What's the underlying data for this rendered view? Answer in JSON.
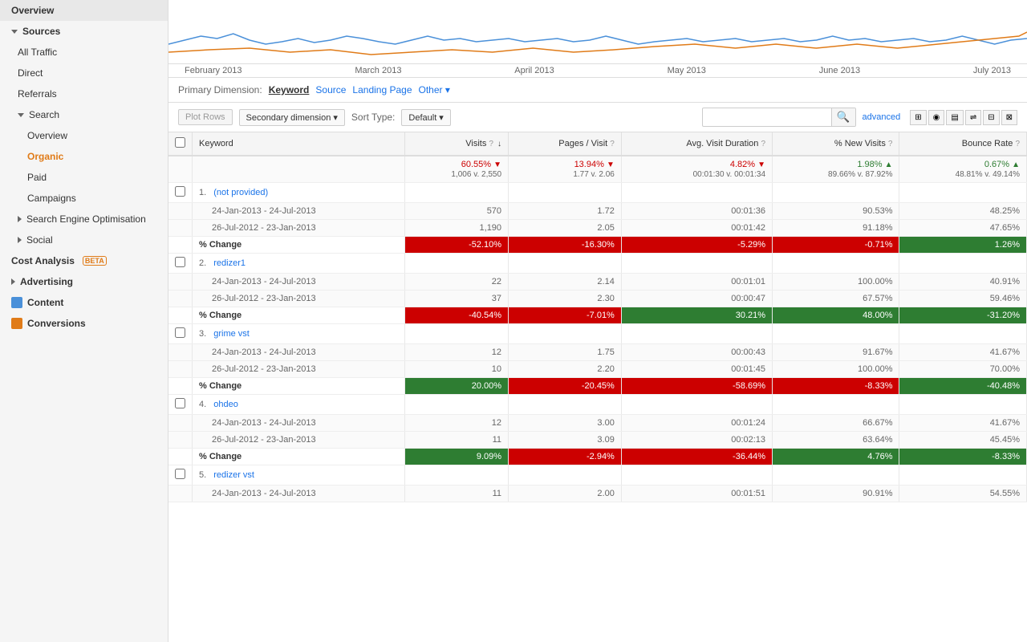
{
  "sidebar": {
    "items": [
      {
        "id": "overview",
        "label": "Overview",
        "level": 1,
        "icon": null,
        "active": false
      },
      {
        "id": "sources",
        "label": "Sources",
        "level": 1,
        "icon": "triangle-down",
        "active": false
      },
      {
        "id": "all-traffic",
        "label": "All Traffic",
        "level": 2,
        "active": false
      },
      {
        "id": "direct",
        "label": "Direct",
        "level": 2,
        "active": false
      },
      {
        "id": "referrals",
        "label": "Referrals",
        "level": 2,
        "active": false
      },
      {
        "id": "search",
        "label": "Search",
        "level": 2,
        "icon": "triangle-down",
        "active": false
      },
      {
        "id": "search-overview",
        "label": "Overview",
        "level": 3,
        "active": false
      },
      {
        "id": "organic",
        "label": "Organic",
        "level": 3,
        "active": true
      },
      {
        "id": "paid",
        "label": "Paid",
        "level": 3,
        "active": false
      },
      {
        "id": "campaigns",
        "label": "Campaigns",
        "level": 3,
        "active": false
      },
      {
        "id": "seo",
        "label": "Search Engine Optimisation",
        "level": 2,
        "icon": "triangle-right",
        "active": false
      },
      {
        "id": "social",
        "label": "Social",
        "level": 2,
        "icon": "triangle-right",
        "active": false
      },
      {
        "id": "cost-analysis",
        "label": "Cost Analysis",
        "level": 1,
        "beta": true,
        "active": false
      },
      {
        "id": "advertising",
        "label": "Advertising",
        "level": 1,
        "icon": "triangle-right",
        "active": false
      },
      {
        "id": "content",
        "label": "Content",
        "level": 1,
        "icon": "content-icon",
        "active": false
      },
      {
        "id": "conversions",
        "label": "Conversions",
        "level": 1,
        "icon": "conversions-icon",
        "active": false
      }
    ]
  },
  "chart": {
    "labels": [
      "February 2013",
      "March 2013",
      "April 2013",
      "May 2013",
      "June 2013",
      "July 2013"
    ]
  },
  "dimensions": {
    "label": "Primary Dimension:",
    "options": [
      {
        "id": "keyword",
        "label": "Keyword",
        "active": true
      },
      {
        "id": "source",
        "label": "Source",
        "active": false
      },
      {
        "id": "landing-page",
        "label": "Landing Page",
        "active": false
      },
      {
        "id": "other",
        "label": "Other ▾",
        "active": false
      }
    ]
  },
  "toolbar": {
    "plot_rows": "Plot Rows",
    "secondary_dimension": "Secondary dimension ▾",
    "sort_type": "Sort Type:",
    "sort_default": "Default ▾",
    "advanced": "advanced"
  },
  "table": {
    "headers": [
      {
        "id": "keyword",
        "label": "Keyword",
        "numeric": false
      },
      {
        "id": "visits",
        "label": "Visits",
        "numeric": true,
        "help": true,
        "sort": true
      },
      {
        "id": "pages-visit",
        "label": "Pages / Visit",
        "numeric": true,
        "help": true
      },
      {
        "id": "avg-visit-duration",
        "label": "Avg. Visit Duration",
        "numeric": true,
        "help": true
      },
      {
        "id": "pct-new-visits",
        "label": "% New Visits",
        "numeric": true,
        "help": true
      },
      {
        "id": "bounce-rate",
        "label": "Bounce Rate",
        "numeric": true,
        "help": true
      }
    ],
    "summary": {
      "visits_pct": "60.55%",
      "visits_arrow": "down",
      "visits_compare": "1,006 v. 2,550",
      "pages_pct": "13.94%",
      "pages_arrow": "down",
      "pages_compare": "1.77 v. 2.06",
      "avg_duration_pct": "4.82%",
      "avg_duration_arrow": "down",
      "avg_duration_compare": "00:01:30 v. 00:01:34",
      "new_visits_pct": "1.98%",
      "new_visits_arrow": "up",
      "new_visits_compare": "89.66% v. 87.92%",
      "bounce_pct": "0.67%",
      "bounce_arrow": "up",
      "bounce_compare": "48.81% v. 49.14%"
    },
    "rows": [
      {
        "num": 1,
        "keyword": "(not provided)",
        "link": true,
        "date1": "24-Jan-2013 - 24-Jul-2013",
        "date2": "26-Jul-2012 - 23-Jan-2013",
        "visits1": "570",
        "visits2": "1,190",
        "visits_change": "-52.10%",
        "visits_change_type": "red",
        "pages1": "1.72",
        "pages2": "2.05",
        "pages_change": "-16.30%",
        "pages_change_type": "red",
        "dur1": "00:01:36",
        "dur2": "00:01:42",
        "dur_change": "-5.29%",
        "dur_change_type": "red",
        "new1": "90.53%",
        "new2": "91.18%",
        "new_change": "-0.71%",
        "new_change_type": "red",
        "bounce1": "48.25%",
        "bounce2": "47.65%",
        "bounce_change": "1.26%",
        "bounce_change_type": "green"
      },
      {
        "num": 2,
        "keyword": "redizer1",
        "link": true,
        "date1": "24-Jan-2013 - 24-Jul-2013",
        "date2": "26-Jul-2012 - 23-Jan-2013",
        "visits1": "22",
        "visits2": "37",
        "visits_change": "-40.54%",
        "visits_change_type": "red",
        "pages1": "2.14",
        "pages2": "2.30",
        "pages_change": "-7.01%",
        "pages_change_type": "red",
        "dur1": "00:01:01",
        "dur2": "00:00:47",
        "dur_change": "30.21%",
        "dur_change_type": "green",
        "new1": "100.00%",
        "new2": "67.57%",
        "new_change": "48.00%",
        "new_change_type": "green",
        "bounce1": "40.91%",
        "bounce2": "59.46%",
        "bounce_change": "-31.20%",
        "bounce_change_type": "green"
      },
      {
        "num": 3,
        "keyword": "grime vst",
        "link": true,
        "date1": "24-Jan-2013 - 24-Jul-2013",
        "date2": "26-Jul-2012 - 23-Jan-2013",
        "visits1": "12",
        "visits2": "10",
        "visits_change": "20.00%",
        "visits_change_type": "green",
        "pages1": "1.75",
        "pages2": "2.20",
        "pages_change": "-20.45%",
        "pages_change_type": "red",
        "dur1": "00:00:43",
        "dur2": "00:01:45",
        "dur_change": "-58.69%",
        "dur_change_type": "red",
        "new1": "91.67%",
        "new2": "100.00%",
        "new_change": "-8.33%",
        "new_change_type": "red",
        "bounce1": "41.67%",
        "bounce2": "70.00%",
        "bounce_change": "-40.48%",
        "bounce_change_type": "green"
      },
      {
        "num": 4,
        "keyword": "ohdeo",
        "link": true,
        "date1": "24-Jan-2013 - 24-Jul-2013",
        "date2": "26-Jul-2012 - 23-Jan-2013",
        "visits1": "12",
        "visits2": "11",
        "visits_change": "9.09%",
        "visits_change_type": "green",
        "pages1": "3.00",
        "pages2": "3.09",
        "pages_change": "-2.94%",
        "pages_change_type": "red",
        "dur1": "00:01:24",
        "dur2": "00:02:13",
        "dur_change": "-36.44%",
        "dur_change_type": "red",
        "new1": "66.67%",
        "new2": "63.64%",
        "new_change": "4.76%",
        "new_change_type": "green",
        "bounce1": "41.67%",
        "bounce2": "45.45%",
        "bounce_change": "-8.33%",
        "bounce_change_type": "green"
      },
      {
        "num": 5,
        "keyword": "redizer vst",
        "link": true,
        "date1": "24-Jan-2013 - 24-Jul-2013",
        "date2": "",
        "visits1": "11",
        "visits2": "",
        "visits_change": "",
        "visits_change_type": "",
        "pages1": "2.00",
        "pages2": "",
        "pages_change": "",
        "pages_change_type": "",
        "dur1": "00:01:51",
        "dur2": "",
        "dur_change": "",
        "dur_change_type": "",
        "new1": "90.91%",
        "new2": "",
        "new_change": "",
        "new_change_type": "",
        "bounce1": "54.55%",
        "bounce2": "",
        "bounce_change": "",
        "bounce_change_type": ""
      }
    ]
  }
}
